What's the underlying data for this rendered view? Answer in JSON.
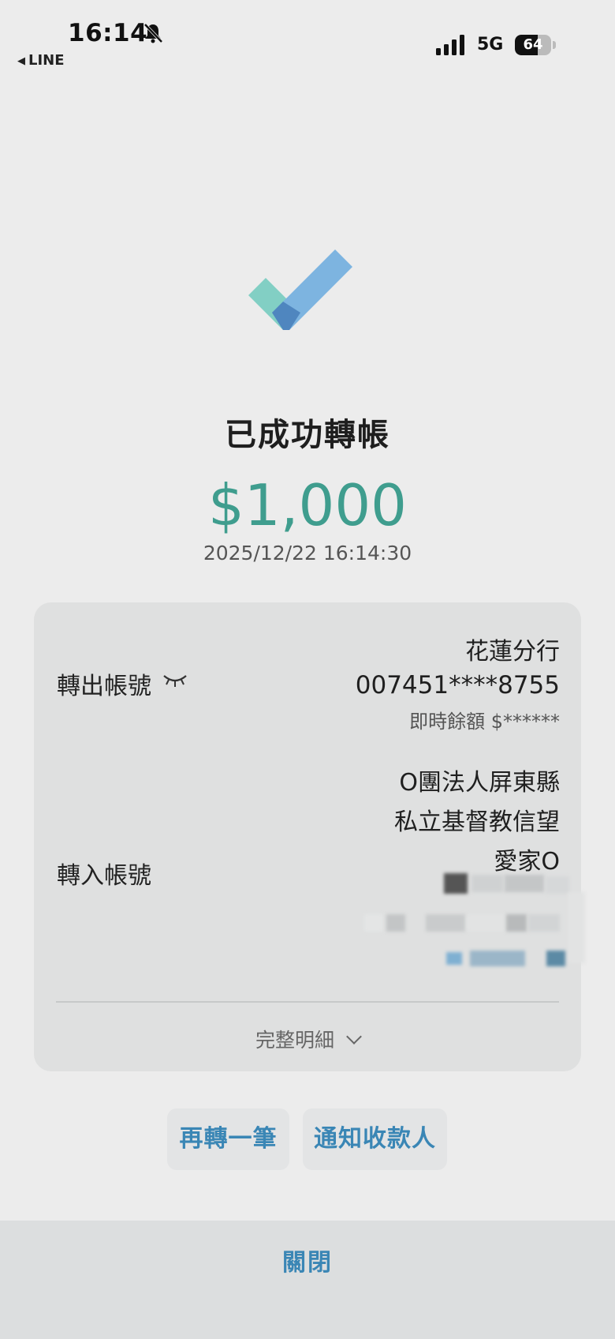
{
  "status_bar": {
    "time": "16:14",
    "back_app": "LINE",
    "network": "5G",
    "battery": "64",
    "battery_level_percent": 64,
    "icons": [
      "bell-slash-icon",
      "signal-icon",
      "battery-icon"
    ]
  },
  "result": {
    "title": "已成功轉帳",
    "amount": "$1,000",
    "datetime": "2025/12/22 16:14:30",
    "icon": "check-icon"
  },
  "detail": {
    "from_label": "轉出帳號",
    "from_bank": "花蓮分行",
    "from_account": "007451****8755",
    "from_balance": "即時餘額 $******",
    "to_label": "轉入帳號",
    "payee_lines": [
      "O團法人屏東縣",
      "私立基督教信望",
      "愛家O"
    ],
    "full_detail": "完整明細"
  },
  "actions": {
    "transfer_again": "再轉一筆",
    "notify_payee": "通知收款人"
  },
  "footer": {
    "close": "關閉"
  },
  "colors": {
    "accent": "#3a86b5",
    "amount": "#3f9d8e",
    "background": "#ececec",
    "card": "#dfe0e0"
  }
}
